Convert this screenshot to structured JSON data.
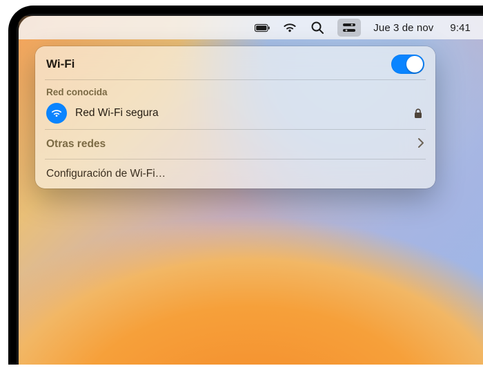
{
  "menubar": {
    "date": "Jue 3 de nov",
    "time": "9:41"
  },
  "popover": {
    "title": "Wi-Fi",
    "wifi_on": true,
    "known_heading": "Red conocida",
    "network": {
      "name": "Red Wi-Fi segura",
      "secured": true,
      "connected": true
    },
    "other_networks_label": "Otras redes",
    "settings_label": "Configuración de Wi-Fi…"
  }
}
